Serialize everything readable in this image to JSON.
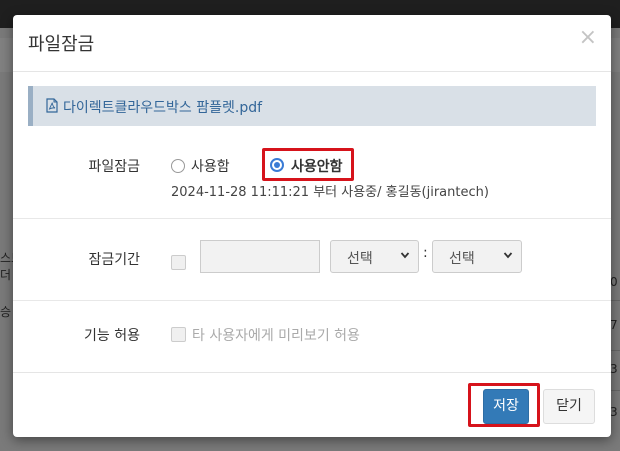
{
  "modal": {
    "title": "파일잠금",
    "close_glyph": "×",
    "file_name": "다이렉트클라우드박스 팜플렛.pdf"
  },
  "lock_section": {
    "label": "파일잠금",
    "options": [
      {
        "label": "사용함",
        "checked": false
      },
      {
        "label": "사용안함",
        "checked": true
      }
    ],
    "info": "2024-11-28 11:11:21 부터 사용중/ 홍길동(jirantech)"
  },
  "period_section": {
    "label": "잠금기간",
    "date_value": "",
    "hour_select": "선택",
    "minute_select": "선택",
    "separator": ":"
  },
  "permission_section": {
    "label": "기능 허용",
    "preview_label": "타 사용자에게 미리보기 허용"
  },
  "buttons": {
    "save": "저장",
    "close": "닫기"
  },
  "background": {
    "sidebar_text": [
      "스트",
      "더",
      "승"
    ],
    "right_column": [
      "0",
      "7",
      "3",
      "3"
    ]
  },
  "colors": {
    "primary": "#337ab7",
    "highlight": "#d6131b",
    "radio_selected": "#3a7bd5"
  }
}
